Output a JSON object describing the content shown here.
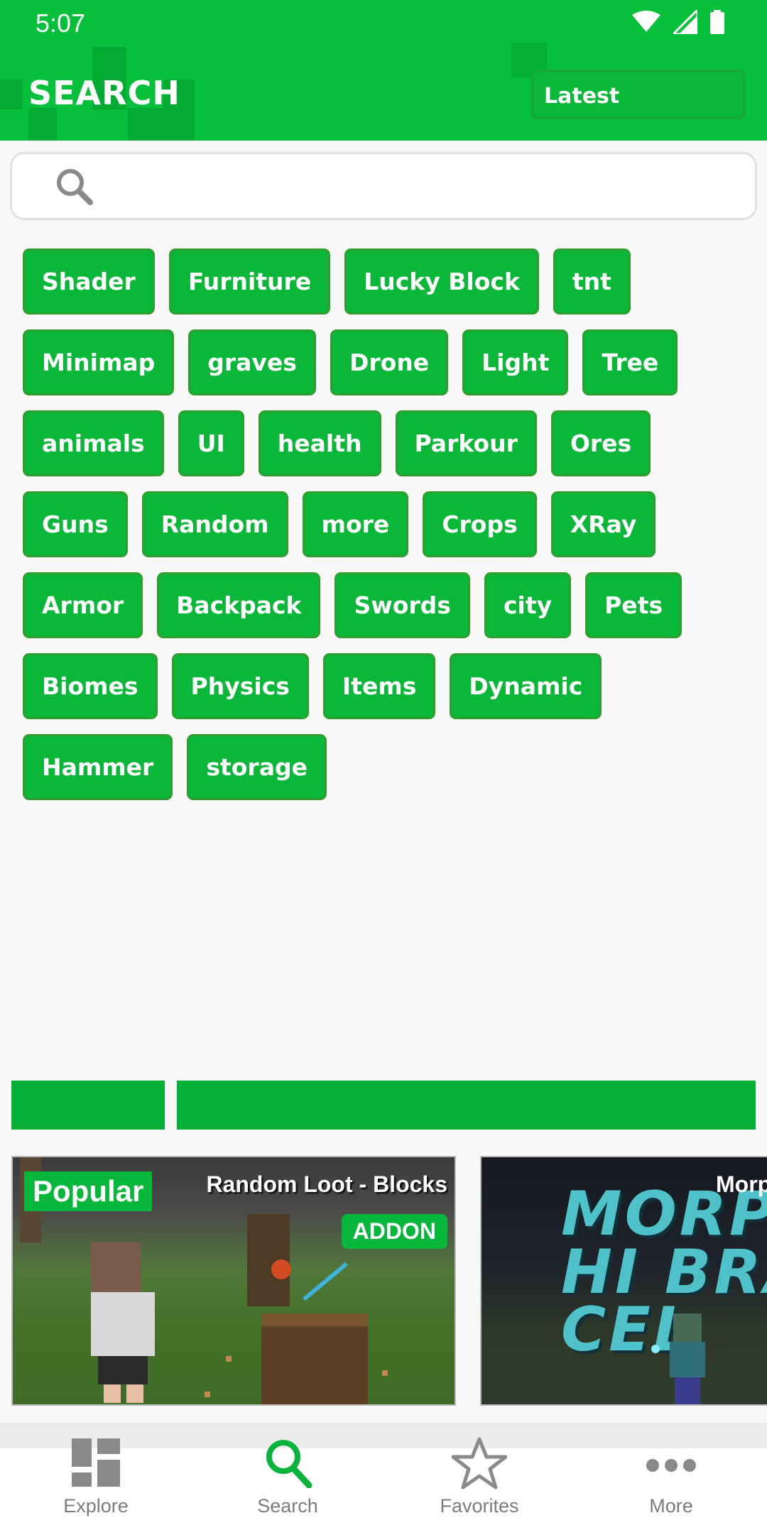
{
  "status_bar": {
    "time": "5:07"
  },
  "header": {
    "title": "SEARCH",
    "sort_button": "Latest",
    "brand_color": "#06bf3a"
  },
  "search": {
    "placeholder": "",
    "value": ""
  },
  "tags": [
    [
      "Shader",
      "Furniture",
      "Lucky Block",
      "tnt"
    ],
    [
      "Minimap",
      "graves",
      "Drone",
      "Light",
      "Tree"
    ],
    [
      "animals",
      "UI",
      "health",
      "Parkour",
      "Ores"
    ],
    [
      "Guns",
      "Random",
      "more",
      "Crops",
      "XRay"
    ],
    [
      "Armor",
      "Backpack",
      "Swords",
      "city",
      "Pets"
    ],
    [
      "Biomes",
      "Physics",
      "Items",
      "Dynamic"
    ],
    [
      "Hammer",
      "storage"
    ]
  ],
  "cards": [
    {
      "badge": "Popular",
      "title": "Random Loot - Blocks",
      "type": "ADDON"
    },
    {
      "image_text": "MORPHI BRACEL",
      "title": "Morp"
    }
  ],
  "bottom_nav": [
    {
      "label": "Explore",
      "icon": "grid-icon"
    },
    {
      "label": "Search",
      "icon": "search-icon",
      "active": true
    },
    {
      "label": "Favorites",
      "icon": "star-icon"
    },
    {
      "label": "More",
      "icon": "more-dots-icon"
    }
  ]
}
